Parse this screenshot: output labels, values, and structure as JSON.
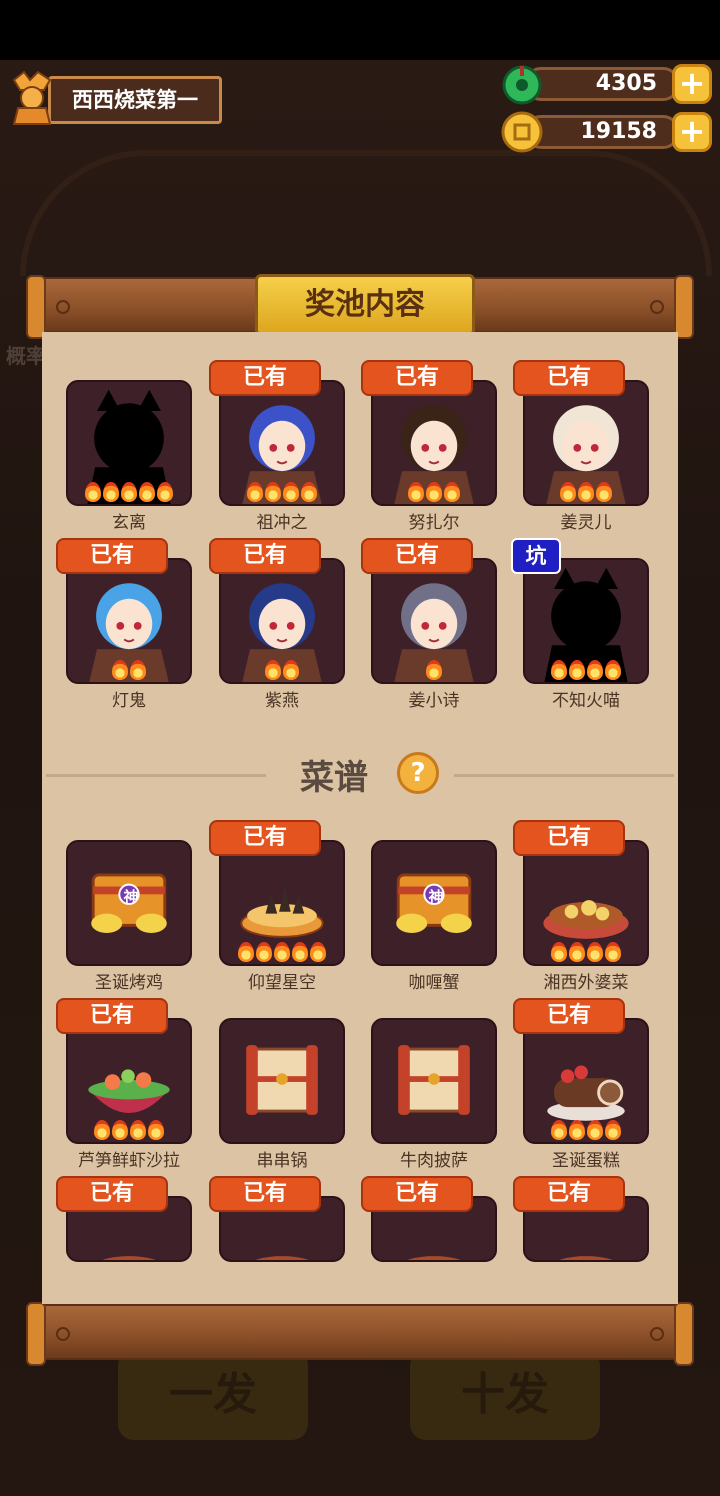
{
  "player": {
    "name": "西西烧菜第一"
  },
  "currency": {
    "jade": "4305",
    "coins": "19158",
    "plus": "+"
  },
  "panel": {
    "title": "奖池内容",
    "recipes_heading": "菜谱",
    "help_glyph": "?"
  },
  "background": {
    "button_1": "一发",
    "button_2": "十发",
    "side_text": "概率"
  },
  "characters": [
    {
      "name": "玄离",
      "owned": false,
      "flames": 5,
      "silhouette": true
    },
    {
      "name": "祖冲之",
      "owned": true,
      "flames": 4,
      "hair": "#3b52c8"
    },
    {
      "name": "努扎尔",
      "owned": true,
      "flames": 3,
      "hair": "#3a2418"
    },
    {
      "name": "姜灵儿",
      "owned": true,
      "flames": 3,
      "hair": "#f1e6d6"
    },
    {
      "name": "灯鬼",
      "owned": true,
      "flames": 2,
      "hair": "#49a3e6"
    },
    {
      "name": "紫燕",
      "owned": true,
      "flames": 2,
      "hair": "#263a8a"
    },
    {
      "name": "姜小诗",
      "owned": true,
      "flames": 1,
      "hair": "#707088"
    },
    {
      "name": "不知火喵",
      "owned": false,
      "flames": 4,
      "silhouette": true,
      "tag": "坑"
    }
  ],
  "recipes": [
    {
      "name": "圣诞烤鸡",
      "owned": false,
      "flames": 0,
      "icon": "god-chest",
      "chest_label": "神"
    },
    {
      "name": "仰望星空",
      "owned": true,
      "flames": 5,
      "icon": "star-gazing-pie"
    },
    {
      "name": "咖喱蟹",
      "owned": false,
      "flames": 0,
      "icon": "god-chest",
      "chest_label": "神"
    },
    {
      "name": "湘西外婆菜",
      "owned": true,
      "flames": 4,
      "icon": "stew-plate"
    },
    {
      "name": "芦笋鲜虾沙拉",
      "owned": true,
      "flames": 4,
      "icon": "salad-bowl"
    },
    {
      "name": "串串锅",
      "owned": false,
      "flames": 0,
      "icon": "scroll-package"
    },
    {
      "name": "牛肉披萨",
      "owned": false,
      "flames": 0,
      "icon": "scroll-package"
    },
    {
      "name": "圣诞蛋糕",
      "owned": true,
      "flames": 4,
      "icon": "yule-log-cake"
    },
    {
      "name": "",
      "owned": true,
      "flames": 0,
      "icon": "partial-dish"
    },
    {
      "name": "",
      "owned": true,
      "flames": 0,
      "icon": "partial-dish"
    },
    {
      "name": "",
      "owned": true,
      "flames": 0,
      "icon": "partial-dish"
    },
    {
      "name": "",
      "owned": true,
      "flames": 0,
      "icon": "partial-dish"
    }
  ],
  "owned_tag": "已有",
  "colors": {
    "owned_tag": "#e4541e",
    "pit_tag": "#1f1fc4",
    "card_bg": "#3d2028",
    "paper": "#dcc3a4"
  }
}
